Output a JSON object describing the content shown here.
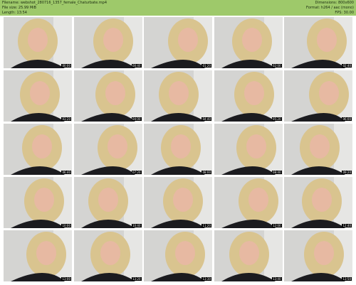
{
  "header": {
    "filename": "Filename: webshot_280716_1357_female_Chaturbate.mp4",
    "filesize": "File size: 25.99 MiB",
    "length": "Length: 13:54",
    "dimensions": "Dimensions: 800x600",
    "format": "Format: h264 / aac (mono)",
    "fps": "FPS: 30.00"
  },
  "thumbs": [
    {
      "time": "00:00"
    },
    {
      "time": "00:40"
    },
    {
      "time": "01:20"
    },
    {
      "time": "02:00"
    },
    {
      "time": "02:40"
    },
    {
      "time": "03:20"
    },
    {
      "time": "04:00"
    },
    {
      "time": "04:40"
    },
    {
      "time": "05:20"
    },
    {
      "time": "06:00"
    },
    {
      "time": "06:40"
    },
    {
      "time": "07:20"
    },
    {
      "time": "08:00"
    },
    {
      "time": "08:40"
    },
    {
      "time": "09:20"
    },
    {
      "time": "10:00"
    },
    {
      "time": "10:40"
    },
    {
      "time": "11:20"
    },
    {
      "time": "12:00"
    },
    {
      "time": "12:40"
    },
    {
      "time": "13:00"
    },
    {
      "time": "13:20"
    },
    {
      "time": "13:30"
    },
    {
      "time": "13:40"
    },
    {
      "time": "13:50"
    }
  ],
  "colors": {
    "header_bg": "#9ec96a",
    "wall": "#d4d4d2",
    "hair": "#d9c48f",
    "skin": "#e7b9a2",
    "shirt": "#1b1b1f"
  }
}
